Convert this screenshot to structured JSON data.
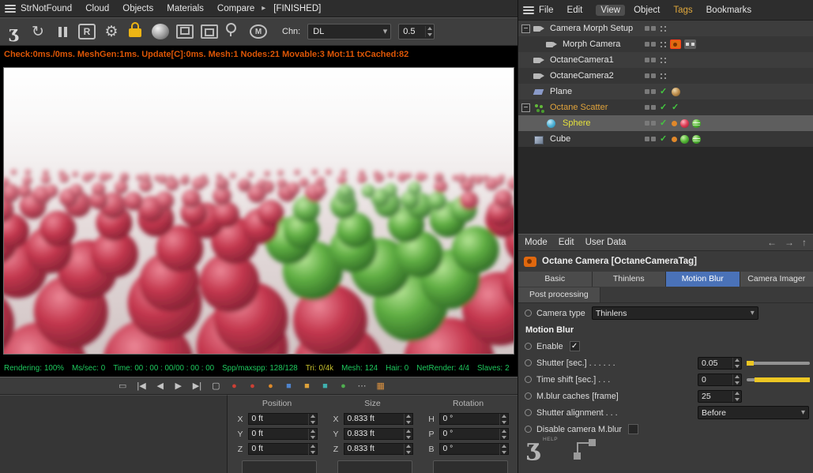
{
  "colors": {
    "accent_blue": "#4a72b8",
    "status_orange": "#dd5606",
    "status_green": "#1ec95e",
    "status_yellow": "#c8c22e",
    "lock_yellow": "#ecb414",
    "slider_yellow": "#ecc623",
    "selected_row": "#5e5e5e"
  },
  "topbar": {
    "left_items": [
      "StrNotFound",
      "Cloud",
      "Objects",
      "Materials",
      "Compare",
      "▸",
      "[FINISHED]"
    ]
  },
  "toolbar": {
    "chn_label": "Chn:",
    "channel_value": "DL",
    "strength_value": "0.5"
  },
  "status_line": "Check:0ms./0ms. MeshGen:1ms. Update[C]:0ms. Mesh:1 Nodes:21 Movable:3 Mot:11 txCached:82",
  "render_bar": [
    {
      "label": "Rendering:",
      "value": "100%",
      "tone": "green"
    },
    {
      "label": "Ms/sec:",
      "value": "0",
      "tone": "green"
    },
    {
      "label": "Time:",
      "value": "00 : 00 : 00/00 : 00 : 00",
      "tone": "green"
    },
    {
      "label": "Spp/maxspp:",
      "value": "128/128",
      "tone": "green"
    },
    {
      "label": "Tri:",
      "value": "0/4k",
      "tone": "yellow"
    },
    {
      "label": "Mesh:",
      "value": "124",
      "tone": "green"
    },
    {
      "label": "Hair:",
      "value": "0",
      "tone": "green"
    },
    {
      "label": "NetRender:",
      "value": "4/4",
      "tone": "green"
    },
    {
      "label": "Slaves:",
      "value": "2",
      "tone": "green"
    }
  ],
  "anim_icons": [
    {
      "name": "marker-icon",
      "glyph": "▭",
      "color": "#b4b4b4"
    },
    {
      "name": "goto-start-icon",
      "glyph": "|◀",
      "color": "#c4c4c4"
    },
    {
      "name": "prev-frame-icon",
      "glyph": "◀",
      "color": "#c4c4c4"
    },
    {
      "name": "play-icon",
      "glyph": "▶",
      "color": "#c4c4c4"
    },
    {
      "name": "goto-end-icon",
      "glyph": "▶|",
      "color": "#c4c4c4"
    },
    {
      "name": "loop-icon",
      "glyph": "▢",
      "color": "#c4c4c4"
    },
    {
      "name": "record-icon",
      "glyph": "●",
      "color": "#cc4034"
    },
    {
      "name": "record-objects-icon",
      "glyph": "●",
      "color": "#cc4034"
    },
    {
      "name": "keyframe-icon",
      "glyph": "●",
      "color": "#de8a2a"
    },
    {
      "name": "autokey-icon",
      "glyph": "■",
      "color": "#4f84cc"
    },
    {
      "name": "key-position-icon",
      "glyph": "■",
      "color": "#dea23a"
    },
    {
      "name": "key-scale-icon",
      "glyph": "■",
      "color": "#3fb0ae"
    },
    {
      "name": "key-rotation-icon",
      "glyph": "●",
      "color": "#4fae4f"
    },
    {
      "name": "more-icon",
      "glyph": "⋯",
      "color": "#b4b4b4"
    },
    {
      "name": "palette-icon",
      "glyph": "▦",
      "color": "#d89040"
    }
  ],
  "object_manager": {
    "menu_items": [
      "File",
      "Edit",
      "View",
      "Object",
      "Tags",
      "Bookmarks"
    ],
    "items": [
      {
        "label": "Camera Morph Setup",
        "depth": 0,
        "icon": "camera",
        "expander": true,
        "tags": [
          "squares",
          "dots"
        ]
      },
      {
        "label": "Morph Camera",
        "depth": 1,
        "icon": "camera",
        "tags": [
          "squares",
          "dots",
          "cam-tag",
          "morph-tag"
        ]
      },
      {
        "label": "OctaneCamera1",
        "depth": 0,
        "icon": "camera",
        "tags": [
          "squares",
          "dots"
        ]
      },
      {
        "label": "OctaneCamera2",
        "depth": 0,
        "icon": "camera",
        "tags": [
          "squares",
          "dots"
        ]
      },
      {
        "label": "Plane",
        "depth": 0,
        "icon": "plane",
        "tags": [
          "squares",
          "check",
          "ball-tan"
        ]
      },
      {
        "label": "Octane Scatter",
        "depth": 0,
        "icon": "scatter",
        "expander": true,
        "label_color": "#e0a33c",
        "tags": [
          "squares",
          "check",
          "check"
        ]
      },
      {
        "label": "Sphere",
        "depth": 1,
        "icon": "sphere",
        "selected": true,
        "label_color": "#e6e23c",
        "tags": [
          "squares",
          "check",
          "dot-orange",
          "ball-red",
          "ball-phong"
        ]
      },
      {
        "label": "Cube",
        "depth": 0,
        "icon": "cube",
        "tags": [
          "squares",
          "check",
          "dot-orange",
          "ball-green",
          "ball-phong"
        ]
      }
    ]
  },
  "attribute_manager": {
    "menu_items": [
      "Mode",
      "Edit",
      "User Data"
    ],
    "nav_icons": [
      "←",
      "→",
      "↑"
    ],
    "title": "Octane Camera [OctaneCameraTag]",
    "tabs_row1": [
      "Basic",
      "Thinlens",
      "Motion Blur",
      "Camera Imager"
    ],
    "tabs_row2": [
      "Post processing"
    ],
    "active_tab": "Motion Blur",
    "rows": [
      {
        "kind": "dropdown",
        "label": "Camera type",
        "value": "Thinlens"
      },
      {
        "kind": "section",
        "label": "Motion Blur"
      },
      {
        "kind": "checkbox",
        "label": "Enable",
        "checked": true
      },
      {
        "kind": "slider",
        "label": "Shutter [sec.] . . . . . .",
        "value": "0.05",
        "fill": "left"
      },
      {
        "kind": "slider",
        "label": "Time shift [sec.] . . .",
        "value": "0",
        "fill": "right"
      },
      {
        "kind": "number",
        "label": "M.blur caches [frame]",
        "value": "25"
      },
      {
        "kind": "dropdown-wide",
        "label": "Shutter alignment . . .",
        "value": "Before"
      },
      {
        "kind": "checkbox",
        "label": "Disable camera M.blur",
        "checked": false
      }
    ],
    "help_label": "HELP"
  },
  "coordinates": {
    "groups": [
      {
        "title": "Position",
        "rows": [
          {
            "axis": "X",
            "value": "0 ft"
          },
          {
            "axis": "Y",
            "value": "0 ft"
          },
          {
            "axis": "Z",
            "value": "0 ft"
          }
        ]
      },
      {
        "title": "Size",
        "rows": [
          {
            "axis": "X",
            "value": "0.833 ft"
          },
          {
            "axis": "Y",
            "value": "0.833 ft"
          },
          {
            "axis": "Z",
            "value": "0.833 ft"
          }
        ]
      },
      {
        "title": "Rotation",
        "rows": [
          {
            "axis": "H",
            "value": "0 °"
          },
          {
            "axis": "P",
            "value": "0 °"
          },
          {
            "axis": "B",
            "value": "0 °"
          }
        ]
      }
    ]
  }
}
